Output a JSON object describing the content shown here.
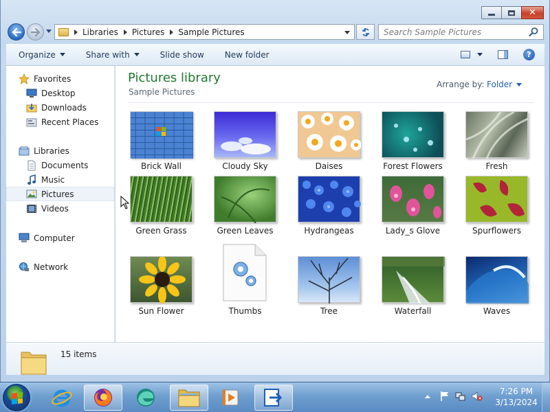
{
  "window": {
    "address": {
      "breadcrumbs": [
        "Libraries",
        "Pictures",
        "Sample Pictures"
      ]
    },
    "search": {
      "placeholder": "Search Sample Pictures"
    },
    "toolbar": {
      "organize": "Organize",
      "share_with": "Share with",
      "slide_show": "Slide show",
      "new_folder": "New folder"
    },
    "sidebar": {
      "items": [
        {
          "label": "Favorites",
          "icon": "star-icon"
        },
        {
          "label": "Desktop",
          "icon": "desktop-icon"
        },
        {
          "label": "Downloads",
          "icon": "downloads-folder-icon"
        },
        {
          "label": "Recent Places",
          "icon": "recent-places-icon"
        },
        {
          "label": "Libraries",
          "icon": "libraries-icon"
        },
        {
          "label": "Documents",
          "icon": "documents-icon"
        },
        {
          "label": "Music",
          "icon": "music-icon"
        },
        {
          "label": "Pictures",
          "icon": "pictures-icon",
          "selected": true
        },
        {
          "label": "Videos",
          "icon": "videos-icon"
        },
        {
          "label": "Computer",
          "icon": "computer-icon"
        },
        {
          "label": "Network",
          "icon": "network-icon"
        }
      ]
    },
    "main": {
      "title": "Pictures library",
      "subtitle": "Sample Pictures",
      "arrange_label": "Arrange by:",
      "arrange_value": "Folder",
      "items": [
        "Brick Wall",
        "Cloudy Sky",
        "Daises",
        "Forest Flowers",
        "Fresh",
        "Green Grass",
        "Green Leaves",
        "Hydrangeas",
        "Lady_s Glove",
        "Spurflowers",
        "Sun Flower",
        "Thumbs",
        "Tree",
        "Waterfall",
        "Waves"
      ]
    },
    "details": {
      "count": "15 items"
    }
  },
  "taskbar": {
    "clock_time": "7:26 PM",
    "clock_date": "3/13/2024",
    "apps": [
      "internet-explorer-icon",
      "firefox-icon",
      "edge-icon",
      "file-explorer-icon",
      "media-player-icon",
      "app-launcher-icon"
    ]
  },
  "colors": {
    "title_green": "#1e7a2e",
    "link_blue": "#1f5fb5",
    "taskbar": "#6f9fcf"
  }
}
